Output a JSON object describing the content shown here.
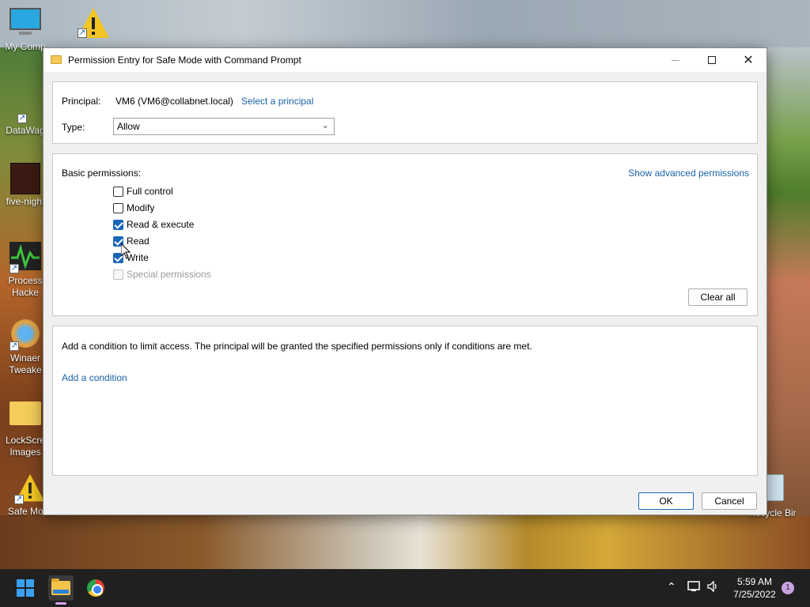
{
  "window": {
    "title": "Permission Entry for Safe Mode with Command Prompt"
  },
  "principal": {
    "label": "Principal:",
    "value": "VM6 (VM6@collabnet.local)",
    "select_link": "Select a principal"
  },
  "type": {
    "label": "Type:",
    "value": "Allow"
  },
  "basic_permissions": {
    "heading": "Basic permissions:",
    "advanced_link": "Show advanced permissions",
    "items": [
      {
        "label": "Full control",
        "checked": false,
        "disabled": false
      },
      {
        "label": "Modify",
        "checked": false,
        "disabled": false
      },
      {
        "label": "Read & execute",
        "checked": true,
        "disabled": false
      },
      {
        "label": "Read",
        "checked": true,
        "disabled": false
      },
      {
        "label": "Write",
        "checked": true,
        "disabled": false
      },
      {
        "label": "Special permissions",
        "checked": false,
        "disabled": true
      }
    ],
    "clear_all": "Clear all"
  },
  "condition": {
    "text": "Add a condition to limit access. The principal will be granted the specified permissions only if conditions are met.",
    "add_link": "Add a condition"
  },
  "buttons": {
    "ok": "OK",
    "cancel": "Cancel"
  },
  "desktop": {
    "icons": [
      {
        "label": "My Comp"
      },
      {
        "label": "DataWag"
      },
      {
        "label": "five-night"
      },
      {
        "label": "Process Hacke"
      },
      {
        "label": "Winaer Tweake"
      },
      {
        "label": "LockScre Images"
      },
      {
        "label": "Safe Mode"
      },
      {
        "label": "Recycle Bin"
      }
    ]
  },
  "taskbar": {
    "time": "5:59 AM",
    "date": "7/25/2022",
    "notifications": "1"
  }
}
